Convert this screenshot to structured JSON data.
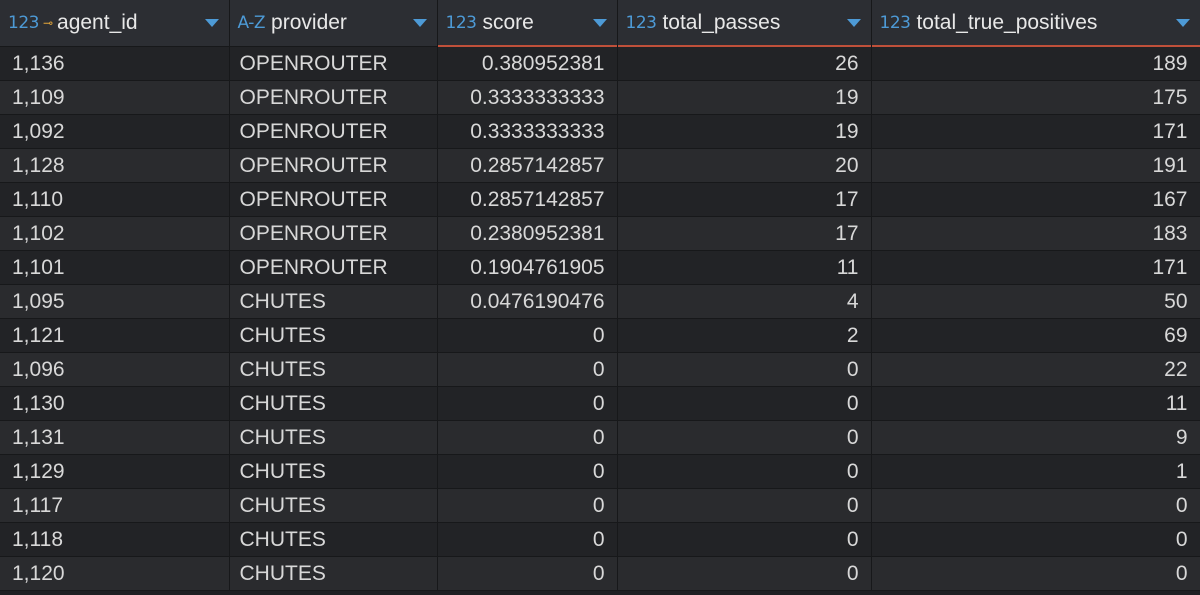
{
  "columns": [
    {
      "type": "123",
      "name": "agent_id",
      "key": true
    },
    {
      "type": "A-Z",
      "name": "provider",
      "key": false
    },
    {
      "type": "123",
      "name": "score",
      "key": false
    },
    {
      "type": "123",
      "name": "total_passes",
      "key": false
    },
    {
      "type": "123",
      "name": "total_true_positives",
      "key": false
    }
  ],
  "rows": [
    [
      "1,136",
      "OPENROUTER",
      "0.380952381",
      "26",
      "189"
    ],
    [
      "1,109",
      "OPENROUTER",
      "0.3333333333",
      "19",
      "175"
    ],
    [
      "1,092",
      "OPENROUTER",
      "0.3333333333",
      "19",
      "171"
    ],
    [
      "1,128",
      "OPENROUTER",
      "0.2857142857",
      "20",
      "191"
    ],
    [
      "1,110",
      "OPENROUTER",
      "0.2857142857",
      "17",
      "167"
    ],
    [
      "1,102",
      "OPENROUTER",
      "0.2380952381",
      "17",
      "183"
    ],
    [
      "1,101",
      "OPENROUTER",
      "0.1904761905",
      "11",
      "171"
    ],
    [
      "1,095",
      "CHUTES",
      "0.0476190476",
      "4",
      "50"
    ],
    [
      "1,121",
      "CHUTES",
      "0",
      "2",
      "69"
    ],
    [
      "1,096",
      "CHUTES",
      "0",
      "0",
      "22"
    ],
    [
      "1,130",
      "CHUTES",
      "0",
      "0",
      "11"
    ],
    [
      "1,131",
      "CHUTES",
      "0",
      "0",
      "9"
    ],
    [
      "1,129",
      "CHUTES",
      "0",
      "0",
      "1"
    ],
    [
      "1,117",
      "CHUTES",
      "0",
      "0",
      "0"
    ],
    [
      "1,118",
      "CHUTES",
      "0",
      "0",
      "0"
    ],
    [
      "1,120",
      "CHUTES",
      "0",
      "0",
      "0"
    ]
  ],
  "colors": {
    "type_badge": "#4d9ad6",
    "key_icon": "#e0a43a",
    "sort_accent": "#c0503a"
  }
}
